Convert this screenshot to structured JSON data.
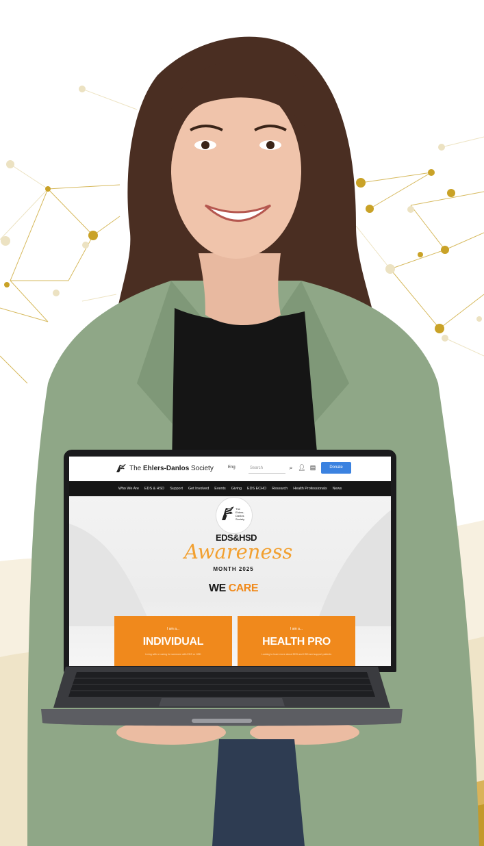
{
  "colors": {
    "accent_orange": "#f0891c",
    "gold": "#c9a227",
    "donate_blue": "#3b82e0",
    "nav_dark": "#161616",
    "jacket_green": "#8fa787"
  },
  "site": {
    "logo_prefix": "The ",
    "logo_bold": "Ehlers-Danlos",
    "logo_suffix": " Society",
    "lang": "Eng",
    "search_placeholder": "Search",
    "icons": [
      "search-icon",
      "user-icon",
      "cart-icon"
    ],
    "donate_label": "Donate",
    "nav": [
      "Who We Are",
      "EDS & HSD",
      "Support",
      "Get Involved",
      "Events",
      "Giving",
      "EDS ECHO",
      "Research",
      "Health Professionals",
      "News"
    ]
  },
  "hero": {
    "badge_lines": [
      "The",
      "Ehlers-",
      "Danlos",
      "Society"
    ],
    "eds_title": "EDS&HSD",
    "awareness": "Awareness",
    "month": "MONTH 2025",
    "we": "WE ",
    "care": "CARE"
  },
  "cards": [
    {
      "lead": "I am a...",
      "title": "INDIVIDUAL",
      "desc": "Living with or caring for someone with EDS or HSD"
    },
    {
      "lead": "I am a...",
      "title": "HEALTH PRO",
      "desc": "Looking to learn more about EDS and HSD and support patients"
    }
  ]
}
